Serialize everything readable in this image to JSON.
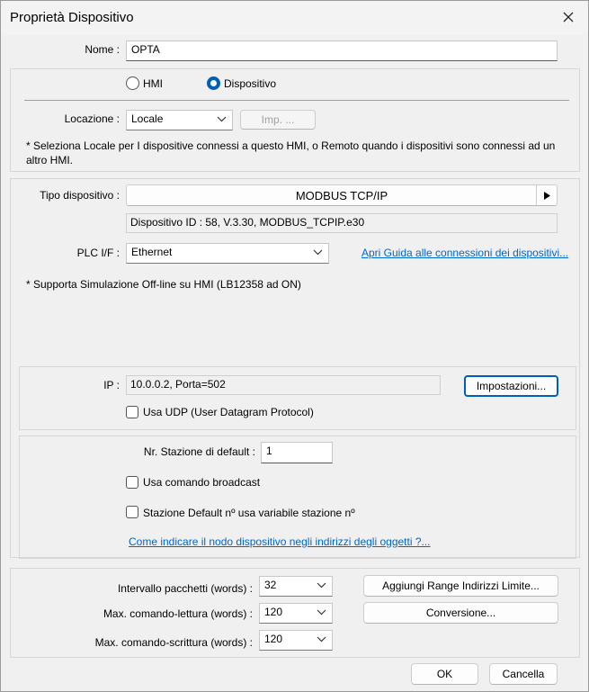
{
  "window": {
    "title": "Proprietà Dispositivo"
  },
  "nome": {
    "label": "Nome :",
    "value": "OPTA"
  },
  "type_selector": {
    "hmi_label": "HMI",
    "dispositivo_label": "Dispositivo",
    "selected": "Dispositivo"
  },
  "locazione": {
    "label": "Locazione :",
    "value": "Locale",
    "imp_button": "Imp. ...",
    "note": "* Seleziona Locale per I dispositive connessi a questo HMI, o Remoto quando i dispositivi sono connessi ad un altro HMI."
  },
  "tipo": {
    "label": "Tipo dispositivo :",
    "value": "MODBUS TCP/IP",
    "info": "Dispositivo ID : 58, V.3.30, MODBUS_TCPIP.e30"
  },
  "plc_if": {
    "label": "PLC I/F :",
    "value": "Ethernet",
    "guide_link": "Apri Guida alle connessioni dei dispositivi..."
  },
  "simulation_note": "* Supporta Simulazione Off-line su HMI (LB12358 ad ON)",
  "ip": {
    "label": "IP :",
    "value": "10.0.0.2,  Porta=502",
    "settings_button": "Impostazioni...",
    "udp_label": "Usa UDP (User Datagram Protocol)",
    "udp_checked": false
  },
  "station": {
    "default_label": "Nr. Stazione di default :",
    "default_value": "1",
    "broadcast_label": "Usa comando broadcast",
    "broadcast_checked": false,
    "variable_label": "Stazione Default nº usa variabile stazione nº",
    "variable_checked": false,
    "help_link": "Come indicare il nodo dispositivo negli indirizzi degli oggetti ?..."
  },
  "packets": {
    "interval_label": "Intervallo pacchetti (words) :",
    "interval_value": "32",
    "read_label": "Max. comando-lettura (words) :",
    "read_value": "120",
    "write_label": "Max. comando-scrittura (words) :",
    "write_value": "120",
    "range_button": "Aggiungi Range Indirizzi Limite...",
    "convert_button": "Conversione..."
  },
  "footer": {
    "ok": "OK",
    "cancel": "Cancella"
  },
  "colors": {
    "accent": "#005fb8",
    "link": "#0066cc"
  }
}
